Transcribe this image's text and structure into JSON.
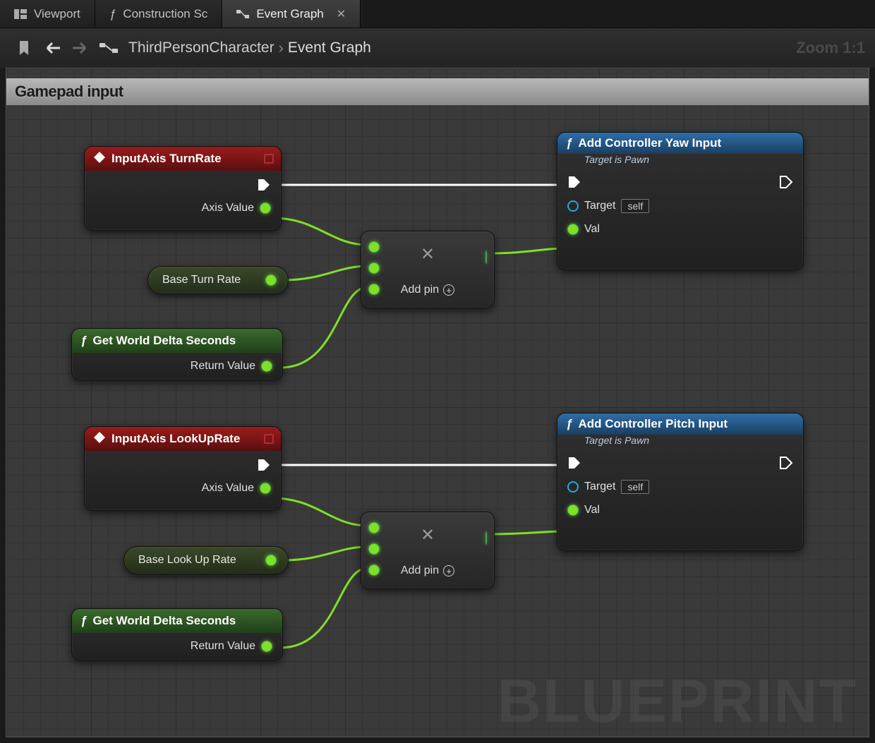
{
  "tabs": [
    {
      "icon": "viewport",
      "label": "Viewport"
    },
    {
      "icon": "func",
      "label": "Construction Sc"
    },
    {
      "icon": "graph",
      "label": "Event Graph",
      "active": true
    }
  ],
  "toolbar": {
    "breadcrumb": [
      "ThirdPersonCharacter",
      "Event Graph"
    ],
    "zoom": "Zoom 1:1"
  },
  "comment_title": "Gamepad input",
  "watermark": "BLUEPRINT",
  "nodes": {
    "input_turn": {
      "title": "InputAxis TurnRate",
      "axis_label": "Axis Value"
    },
    "input_look": {
      "title": "InputAxis LookUpRate",
      "axis_label": "Axis Value"
    },
    "base_turn": {
      "label": "Base Turn Rate"
    },
    "base_look": {
      "label": "Base Look Up Rate"
    },
    "delta1": {
      "title": "Get World Delta Seconds",
      "out": "Return Value"
    },
    "delta2": {
      "title": "Get World Delta Seconds",
      "out": "Return Value"
    },
    "mult": {
      "addpin": "Add pin"
    },
    "yaw": {
      "title": "Add Controller Yaw Input",
      "sub": "Target is Pawn",
      "target": "Target",
      "self": "self",
      "val": "Val"
    },
    "pitch": {
      "title": "Add Controller Pitch Input",
      "sub": "Target is Pawn",
      "target": "Target",
      "self": "self",
      "val": "Val"
    }
  }
}
